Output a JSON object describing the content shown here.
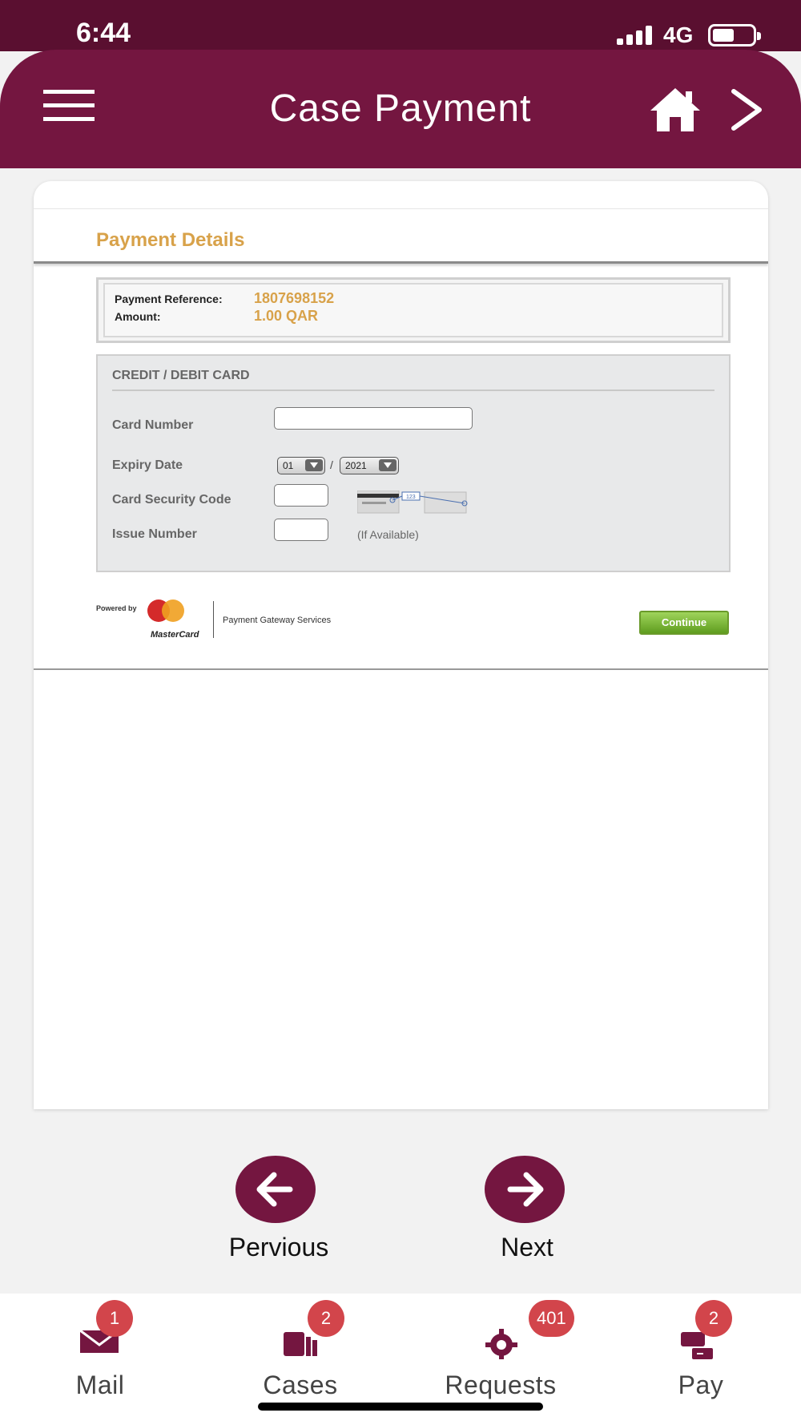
{
  "status_bar": {
    "time": "6:44",
    "network": "4G",
    "battery_level": 0.55
  },
  "header": {
    "title": "Case Payment",
    "menu_icon": "hamburger-menu-icon",
    "home_icon": "home-icon",
    "forward_icon": "chevron-right-icon"
  },
  "payment": {
    "section_title": "Payment Details",
    "reference_label": "Payment Reference:",
    "reference_value": "1807698152",
    "amount_label": "Amount:",
    "amount_value": "1.00 QAR",
    "card_section_title": "CREDIT / DEBIT CARD",
    "card_number_label": "Card Number",
    "card_number_value": "",
    "expiry_label": "Expiry Date",
    "expiry_month": "01",
    "expiry_separator": "/",
    "expiry_year": "2021",
    "security_code_label": "Card Security Code",
    "security_code_value": "",
    "security_code_hint_number": "123",
    "issue_number_label": "Issue Number",
    "issue_number_value": "",
    "issue_number_hint": "(If Available)",
    "powered_by": "Powered by",
    "mastercard_label": "MasterCard",
    "gateway_label": "Payment Gateway Services",
    "continue_label": "Continue"
  },
  "navigation": {
    "previous_label": "Pervious",
    "next_label": "Next"
  },
  "tabs": [
    {
      "label": "Mail",
      "badge": "1",
      "icon": "mail-icon"
    },
    {
      "label": "Cases",
      "badge": "2",
      "icon": "cases-icon"
    },
    {
      "label": "Requests",
      "badge": "401",
      "icon": "requests-gear-icon"
    },
    {
      "label": "Pay",
      "badge": "2",
      "icon": "pay-wallet-icon"
    }
  ],
  "colors": {
    "brand": "#741640",
    "brand_dark": "#5a0f30",
    "accent_gold": "#d8a24a",
    "badge_red": "#d2454b",
    "continue_green": "#7ab83a"
  }
}
